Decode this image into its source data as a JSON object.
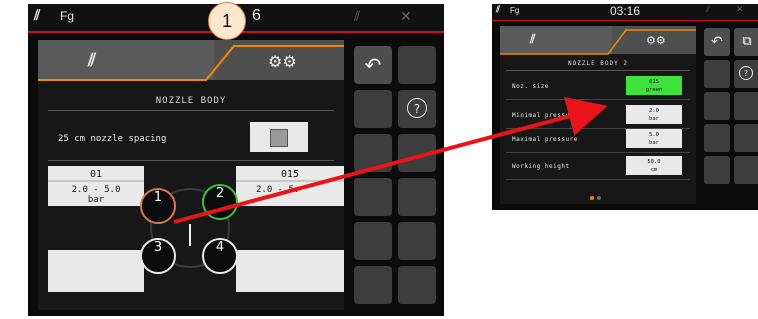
{
  "left_terminal": {
    "statusbar": {
      "fg_label": "Fg",
      "time_partial": "6"
    },
    "callout_number": "1",
    "screen_title": "NOZZLE BODY",
    "nozzle_spacing_label": "25 cm nozzle spacing",
    "nozzle_left_size": "01",
    "nozzle_left_pressure_range": "2.0  -  5.0",
    "nozzle_left_pressure_unit": "bar",
    "nozzle_right_size": "015",
    "nozzle_right_pressure_range": "2.0  -  5.",
    "nozzle_labels": [
      "1",
      "2",
      "3",
      "4"
    ],
    "nozzle_ring_colors": {
      "1": "#d9784a",
      "2": "#3fc23a",
      "3": "#e8e8e8",
      "4": "#e8e8e8"
    },
    "help_glyph": "?"
  },
  "right_terminal": {
    "statusbar": {
      "fg_label": "Fg",
      "time": "03:16"
    },
    "screen_title": "NOZZLE BODY 2",
    "rows": [
      {
        "label": "Noz. size",
        "value_line1": "015",
        "value_line2": "green",
        "highlight": true
      },
      {
        "label": "Minimal pressure",
        "value_line1": "2.0",
        "value_line2": "bar",
        "highlight": false
      },
      {
        "label": "Maximal pressure",
        "value_line1": "5.0",
        "value_line2": "bar",
        "highlight": false
      },
      {
        "label": "Working height",
        "value_line1": "50.0",
        "value_line2": "cm",
        "highlight": false
      }
    ],
    "help_glyph": "?"
  },
  "colors": {
    "accent_red": "#c8102e",
    "tab_orange": "#f08a00",
    "arrow_red": "#e8141a",
    "highlight_green": "#3fe23a"
  }
}
